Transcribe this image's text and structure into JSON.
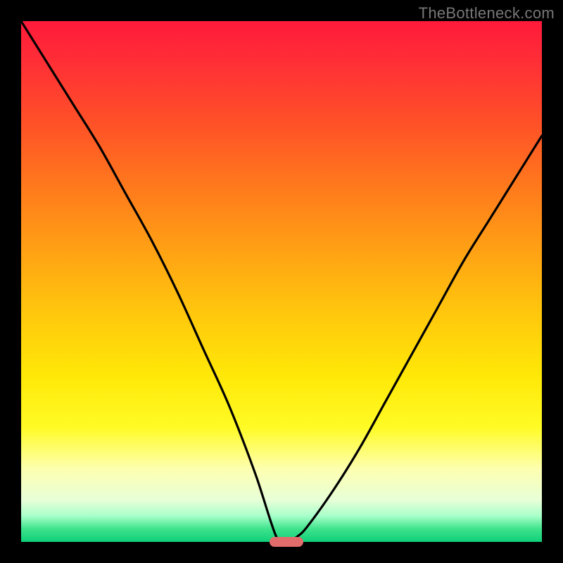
{
  "watermark": "TheBottleneck.com",
  "chart_data": {
    "type": "line",
    "title": "",
    "xlabel": "",
    "ylabel": "",
    "xlim": [
      0,
      100
    ],
    "ylim": [
      0,
      100
    ],
    "grid": false,
    "legend": false,
    "series": [
      {
        "name": "bottleneck-curve",
        "x": [
          0,
          5,
          10,
          15,
          20,
          25,
          30,
          35,
          40,
          45,
          49,
          51,
          53,
          55,
          60,
          65,
          70,
          75,
          80,
          85,
          90,
          95,
          100
        ],
        "y": [
          100,
          92,
          84,
          76,
          67,
          58,
          48,
          37,
          26,
          13,
          1,
          0,
          1,
          3,
          10,
          18,
          27,
          36,
          45,
          54,
          62,
          70,
          78
        ]
      }
    ],
    "marker": {
      "x": 51,
      "y": 0
    },
    "background_gradient": {
      "top": "#ff1a3a",
      "mid": "#ffe807",
      "bottom": "#0fcf7a"
    }
  }
}
